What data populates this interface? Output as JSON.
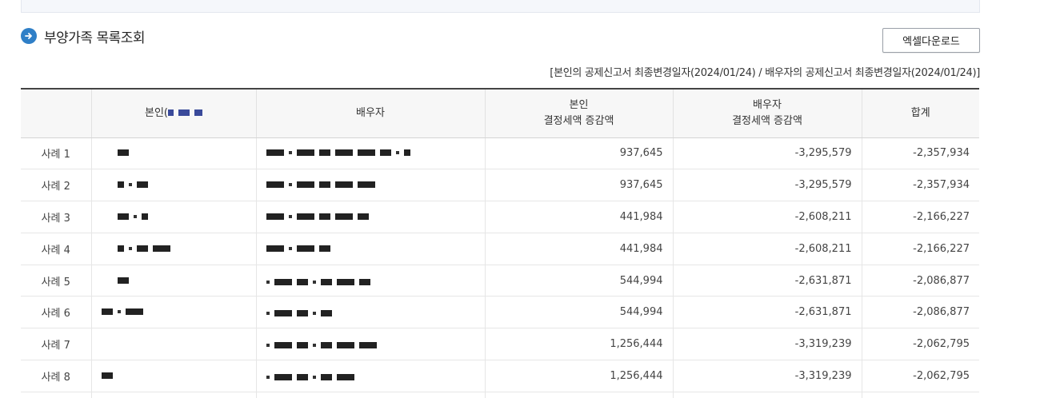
{
  "section": {
    "title": "부양가족 목록조회",
    "icon": "arrow-right-circle-icon"
  },
  "toolbar": {
    "excel_label": "엑셀다운로드"
  },
  "note": {
    "text": "[본인의 공제신고서 최종변경일자(2024/01/24) / 배우자의 공제신고서 최종변경일자(2024/01/24)]"
  },
  "table": {
    "headers": {
      "col1": "",
      "col2": "본인(",
      "col3": "배우자",
      "col4_line1": "본인",
      "col4_line2": "결정세액 증감액",
      "col5_line1": "배우자",
      "col5_line2": "결정세액 증감액",
      "col6": "합계"
    },
    "rows": [
      {
        "label": "사례 1",
        "self": "937,645",
        "spouse": "-3,295,579",
        "total": "-2,357,934"
      },
      {
        "label": "사례 2",
        "self": "937,645",
        "spouse": "-3,295,579",
        "total": "-2,357,934"
      },
      {
        "label": "사례 3",
        "self": "441,984",
        "spouse": "-2,608,211",
        "total": "-2,166,227"
      },
      {
        "label": "사례 4",
        "self": "441,984",
        "spouse": "-2,608,211",
        "total": "-2,166,227"
      },
      {
        "label": "사례 5",
        "self": "544,994",
        "spouse": "-2,631,871",
        "total": "-2,086,877"
      },
      {
        "label": "사례 6",
        "self": "544,994",
        "spouse": "-2,631,871",
        "total": "-2,086,877"
      },
      {
        "label": "사례 7",
        "self": "1,256,444",
        "spouse": "-3,319,239",
        "total": "-2,062,795"
      },
      {
        "label": "사례 8",
        "self": "1,256,444",
        "spouse": "-3,319,239",
        "total": "-2,062,795"
      }
    ]
  },
  "colors": {
    "accent": "#2f7fc7",
    "header_bg": "#f7f7f7",
    "header_top_border": "#444444"
  }
}
